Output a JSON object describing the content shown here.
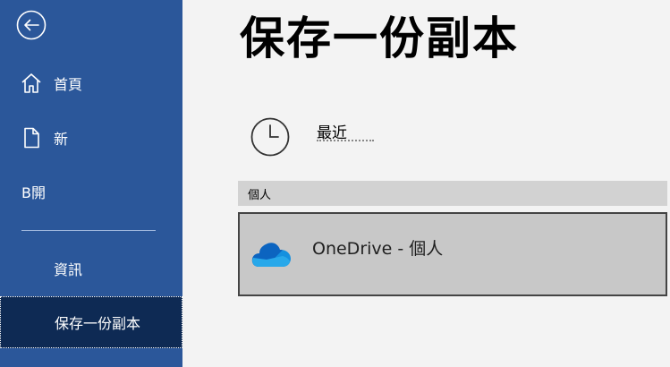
{
  "sidebar": {
    "items": [
      {
        "label": "首頁",
        "icon": "home-icon"
      },
      {
        "label": "新",
        "icon": "new-document-icon"
      },
      {
        "label": "B開"
      },
      {
        "label": "資訊"
      },
      {
        "label": "保存一份副本"
      }
    ]
  },
  "main": {
    "title": "保存一份副本",
    "recent": {
      "label": "最近",
      "icon": "clock-icon"
    },
    "section": {
      "label": "個人"
    },
    "location": {
      "label": "OneDrive - 個人",
      "icon": "onedrive-cloud-icon"
    }
  },
  "colors": {
    "sidebar": "#2b579a",
    "sidebar_selected": "#0e2a54",
    "content_background": "#f3f3f3",
    "section_header": "#d2d2d2",
    "tile": "#c8c8c8",
    "onedrive_blue": "#0f78d4"
  }
}
